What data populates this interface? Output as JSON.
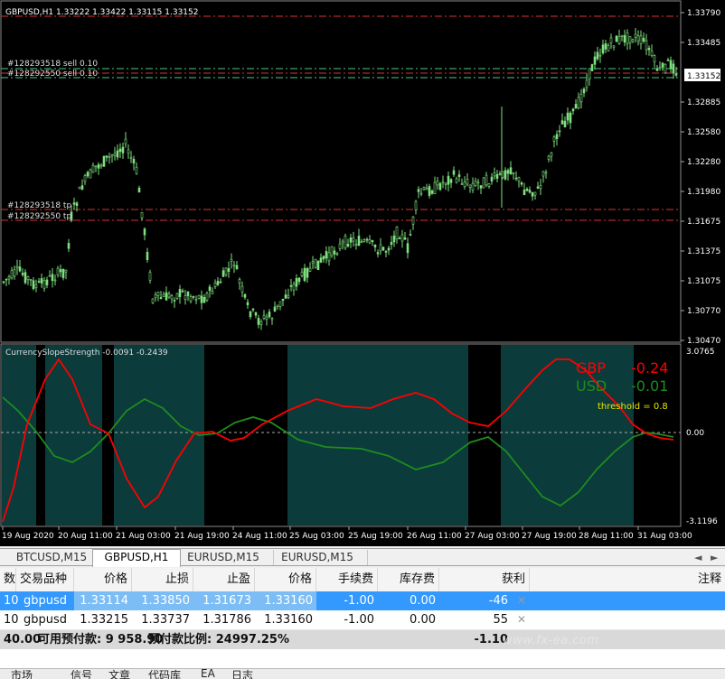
{
  "main_chart": {
    "header": "GBPUSD,H1  1.33222 1.33422 1.33115 1.33152",
    "price_labels": [
      "1.33790",
      "1.33485",
      "1.33152",
      "1.32885",
      "1.32580",
      "1.32280",
      "1.31980",
      "1.31675",
      "1.31375",
      "1.31075",
      "1.30770",
      "1.30470"
    ],
    "current_price": "1.33152",
    "order_lines": {
      "sell1": "#128293518 sell 0.10",
      "sell2": "#128292550 sell 0.10",
      "tp1": "#128293518 tp",
      "tp2": "#128292550 tp"
    }
  },
  "indicator": {
    "header": "CurrencySlopeStrength -0.0091 -0.2439",
    "gbp_name": "GBP",
    "gbp_value": "-0.24",
    "usd_name": "USD",
    "usd_value": "-0.01",
    "threshold": "threshold = 0.8",
    "scale_top": "3.0765",
    "scale_mid": "0.00",
    "scale_bottom": "-3.1196",
    "gbp_color": "#ff0000",
    "usd_color": "#1e8c1e",
    "bg_color": "#0b3b3b"
  },
  "time_axis": [
    "19 Aug 2020",
    "20 Aug 11:00",
    "21 Aug 03:00",
    "21 Aug 19:00",
    "24 Aug 11:00",
    "25 Aug 03:00",
    "25 Aug 19:00",
    "26 Aug 11:00",
    "27 Aug 03:00",
    "27 Aug 19:00",
    "28 Aug 11:00",
    "31 Aug 03:00"
  ],
  "chart_tabs": [
    "BTCUSD,M15",
    "GBPUSD,H1",
    "EURUSD,M15",
    "EURUSD,M15"
  ],
  "chart_tab_nav": {
    "left": "◄",
    "right": "►"
  },
  "table": {
    "headers": {
      "qty": "数",
      "symbol": "交易品种",
      "price": "价格",
      "sl": "止损",
      "tp": "止盈",
      "cur_price": "价格",
      "commission": "手续费",
      "swap": "库存费",
      "profit": "获利",
      "comment": "注释"
    },
    "rows": [
      {
        "qty": "10",
        "symbol": "gbpusd",
        "price": "1.33114",
        "sl": "1.33850",
        "tp": "1.31673",
        "cur_price": "1.33160",
        "commission": "-1.00",
        "swap": "0.00",
        "profit": "-46",
        "close": "✕"
      },
      {
        "qty": "10",
        "symbol": "gbpusd",
        "price": "1.33215",
        "sl": "1.33737",
        "tp": "1.31786",
        "cur_price": "1.33160",
        "commission": "-1.00",
        "swap": "0.00",
        "profit": "55",
        "close": "✕"
      }
    ],
    "summary": {
      "balance": "40.00",
      "free_margin": "可用预付款: 9 958.90",
      "margin_level": "预付款比例: 24997.25%",
      "profit": "-1.10"
    }
  },
  "bottom_tabs": [
    "市场",
    "信号",
    "文章",
    "代码库",
    "EA",
    "日志"
  ],
  "watermark": "www.fx-ea.com"
}
